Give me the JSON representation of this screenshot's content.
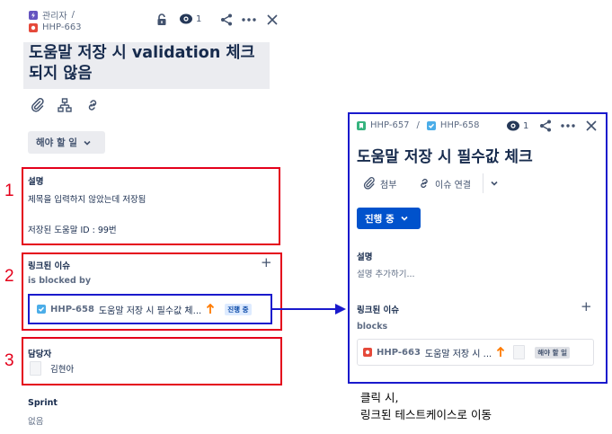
{
  "left": {
    "breadcrumb": {
      "project": "관리자",
      "separator": "/",
      "issue_key": "HHP-663"
    },
    "watch_count": "1",
    "title": "도움말 저장 시 validation 체크되지 않음",
    "status": "해야 할 일",
    "description": {
      "label": "설명",
      "line1": "제목을 입력하지 않았는데 저장됨",
      "line2": "저장된 도움말 ID : 99번"
    },
    "linked": {
      "label": "링크된 이슈",
      "add": "+",
      "relation": "is blocked by",
      "item": {
        "key": "HHP-658",
        "summary": "도움말 저장 시 필수값 체...",
        "status": "진행 중"
      }
    },
    "assignee": {
      "label": "담당자",
      "name": "김현아"
    },
    "sprint": {
      "label": "Sprint",
      "value": "없음"
    }
  },
  "markers": {
    "one": "1",
    "two": "2",
    "three": "3"
  },
  "right": {
    "breadcrumb": {
      "parent_key": "HHP-657",
      "separator": "/",
      "issue_key": "HHP-658"
    },
    "watch_count": "1",
    "title": "도움말 저장 시 필수값 체크",
    "attach_label": "첨부",
    "link_label": "이슈 연결",
    "status": "진행 중",
    "description": {
      "label": "설명",
      "placeholder": "설명 추가하기..."
    },
    "linked": {
      "label": "링크된 이슈",
      "add": "+",
      "relation": "blocks",
      "item": {
        "key": "HHP-663",
        "summary": "도움말 저장 시 ...",
        "status": "해야 할 일"
      }
    }
  },
  "annotation": {
    "line1": "클릭 시,",
    "line2": "링크된 테스트케이스로 이동"
  },
  "colors": {
    "annotation_red": "#e4001b",
    "annotation_blue": "#1a1acc",
    "primary_blue": "#0052cc",
    "priority_orange": "#ff7a00",
    "bug_red": "#e5493a",
    "task_blue": "#4bade8",
    "story_green": "#36b37e",
    "project_purple": "#6554c0"
  },
  "icons": {
    "project": "lightning-project-icon",
    "bug": "bug-icon",
    "task": "task-icon",
    "story": "story-icon",
    "lock": "lock-icon",
    "watch": "eye-icon",
    "share": "share-icon",
    "more": "more-icon",
    "close": "close-icon",
    "attach": "paperclip-icon",
    "child": "child-issues-icon",
    "link": "link-icon",
    "chevron": "chevron-down-icon",
    "priority": "priority-high-arrow-icon"
  }
}
